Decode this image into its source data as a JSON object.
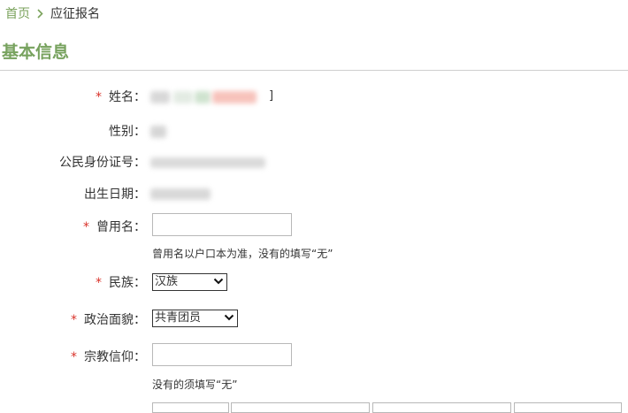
{
  "breadcrumb": {
    "home": "首页",
    "current": "应征报名"
  },
  "section": {
    "title": "基本信息"
  },
  "fields": {
    "name": {
      "required_mark": "*",
      "label": "姓名：",
      "trailing": "]"
    },
    "gender": {
      "label": "性别："
    },
    "id_number": {
      "label": "公民身份证号："
    },
    "birth_date": {
      "label": "出生日期："
    },
    "former_name": {
      "required_mark": "*",
      "label": "曾用名：",
      "value": "",
      "hint": "曾用名以户口本为准，没有的填写“无”"
    },
    "ethnicity": {
      "required_mark": "*",
      "label": "民族：",
      "selected": "汉族"
    },
    "political_status": {
      "required_mark": "*",
      "label": "政治面貌：",
      "selected": "共青团员"
    },
    "religion": {
      "required_mark": "*",
      "label": "宗教信仰：",
      "value": "",
      "hint": "没有的须填写“无”"
    }
  },
  "colors": {
    "accent": "#77a25e",
    "required": "#d9322a"
  },
  "icons": {
    "breadcrumb_separator": "chevron-right-icon",
    "select_arrow": "chevron-down-icon"
  }
}
